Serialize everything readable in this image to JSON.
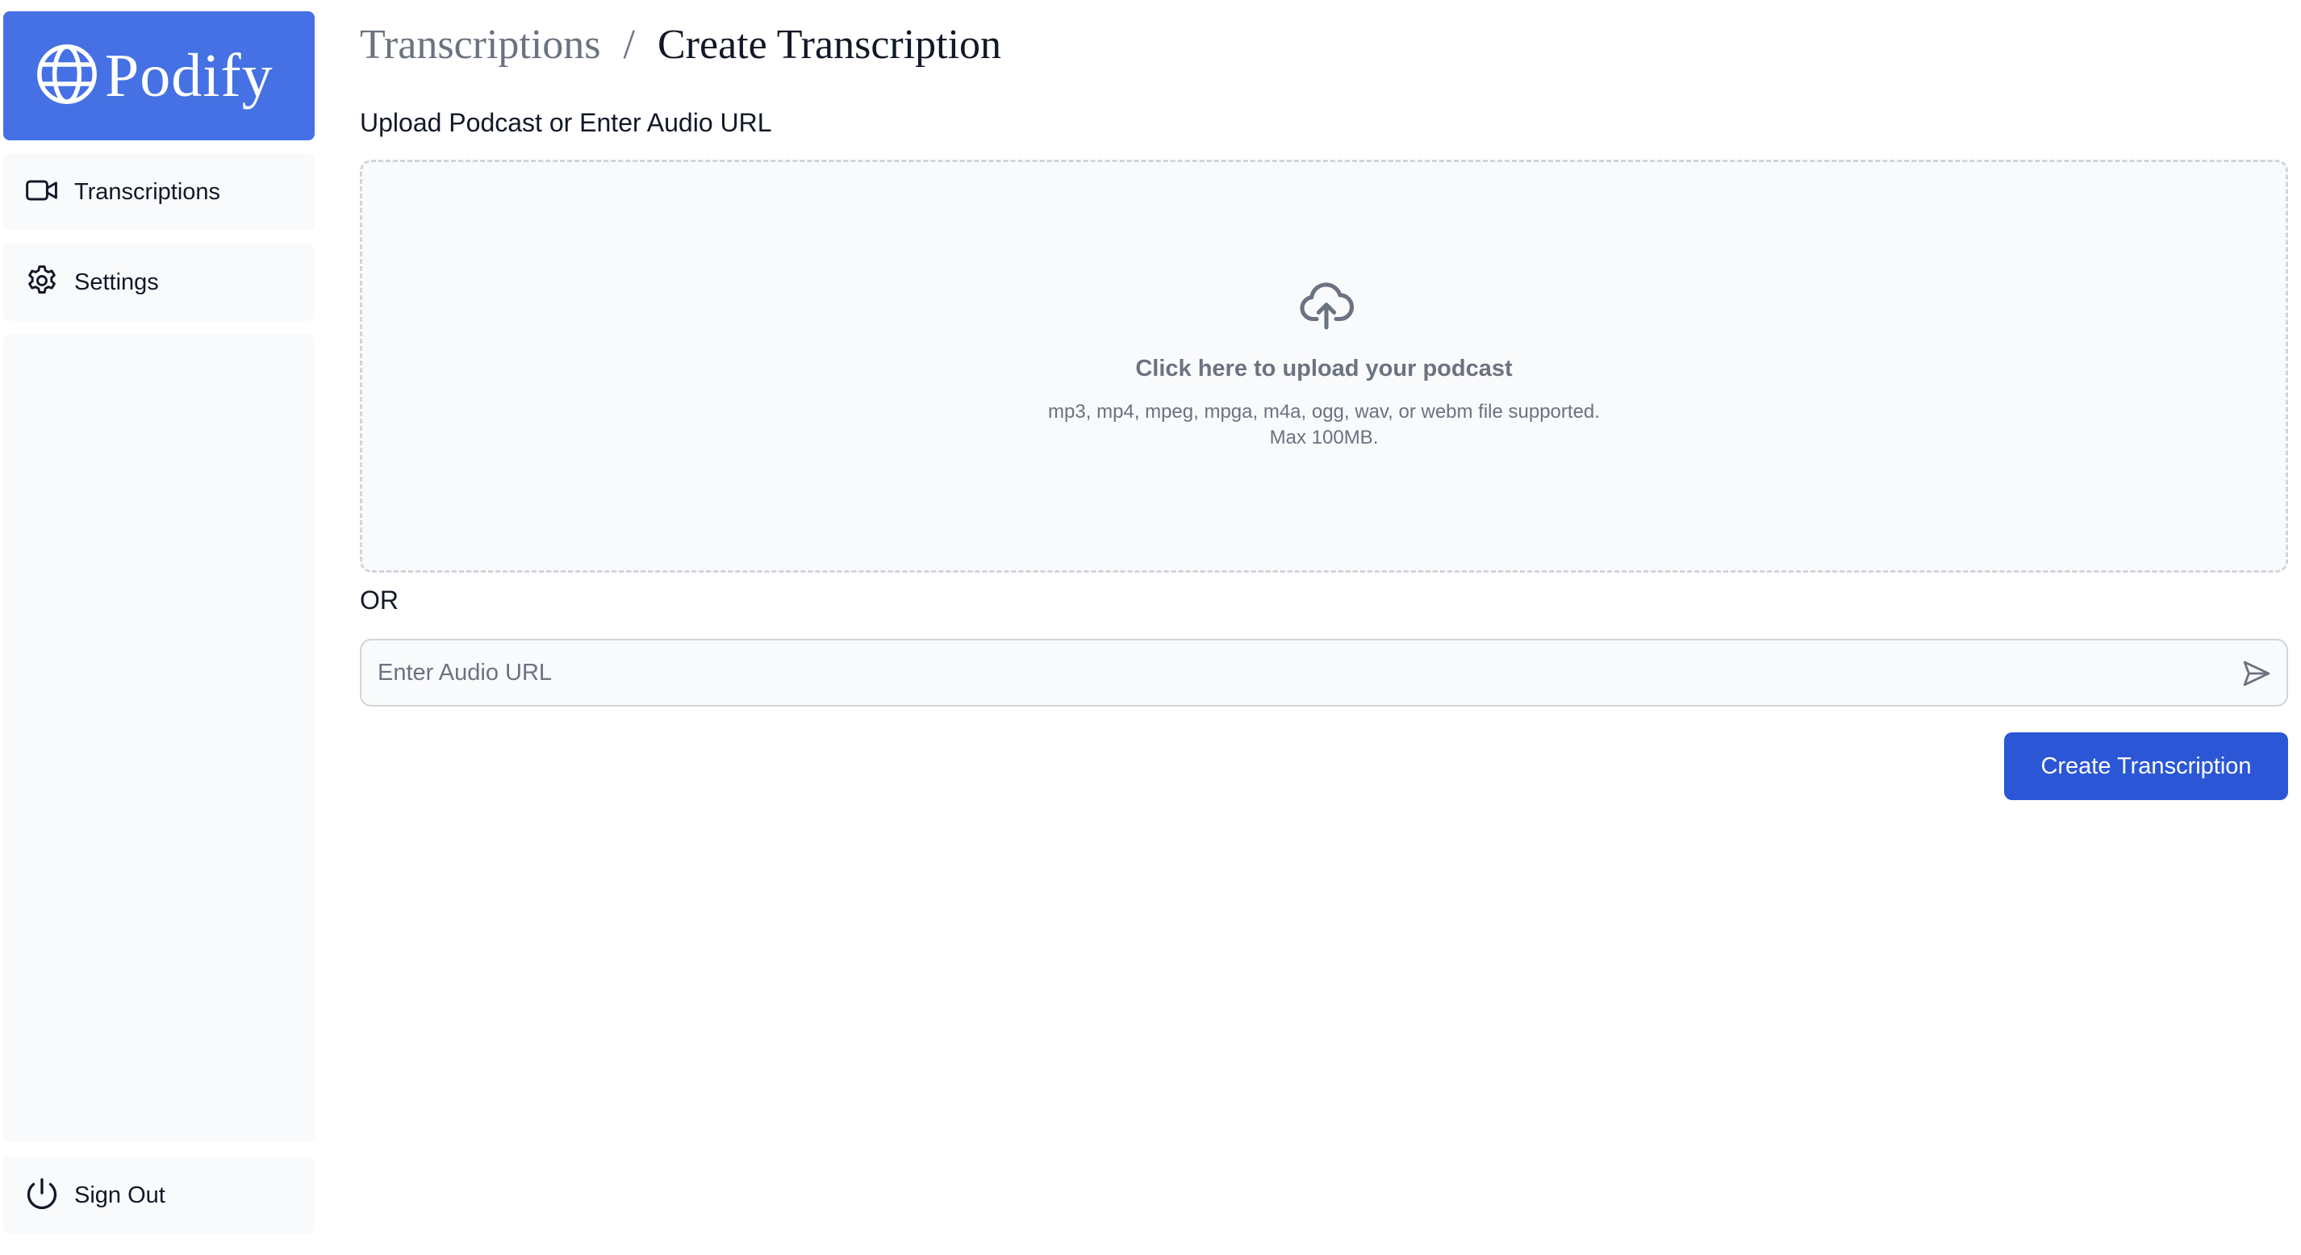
{
  "brand": {
    "name": "Podify",
    "color": "#4571e4",
    "icon": "globe-icon"
  },
  "sidebar": {
    "items": [
      {
        "label": "Transcriptions",
        "icon": "video-camera-icon"
      },
      {
        "label": "Settings",
        "icon": "gear-icon"
      }
    ],
    "signout": {
      "label": "Sign Out",
      "icon": "power-icon"
    }
  },
  "breadcrumb": {
    "parent": "Transcriptions",
    "separator": "/",
    "current": "Create Transcription"
  },
  "upload": {
    "section_label": "Upload Podcast or Enter Audio URL",
    "icon": "cloud-upload-icon",
    "title": "Click here to upload your podcast",
    "hint_line1": "mp3, mp4, mpeg, mpga, m4a, ogg, wav, or webm file supported.",
    "hint_line2": "Max 100MB."
  },
  "or_label": "OR",
  "url_input": {
    "placeholder": "Enter Audio URL",
    "value": "",
    "icon": "send-icon"
  },
  "actions": {
    "create_label": "Create Transcription",
    "primary_color": "#2b57d6"
  }
}
